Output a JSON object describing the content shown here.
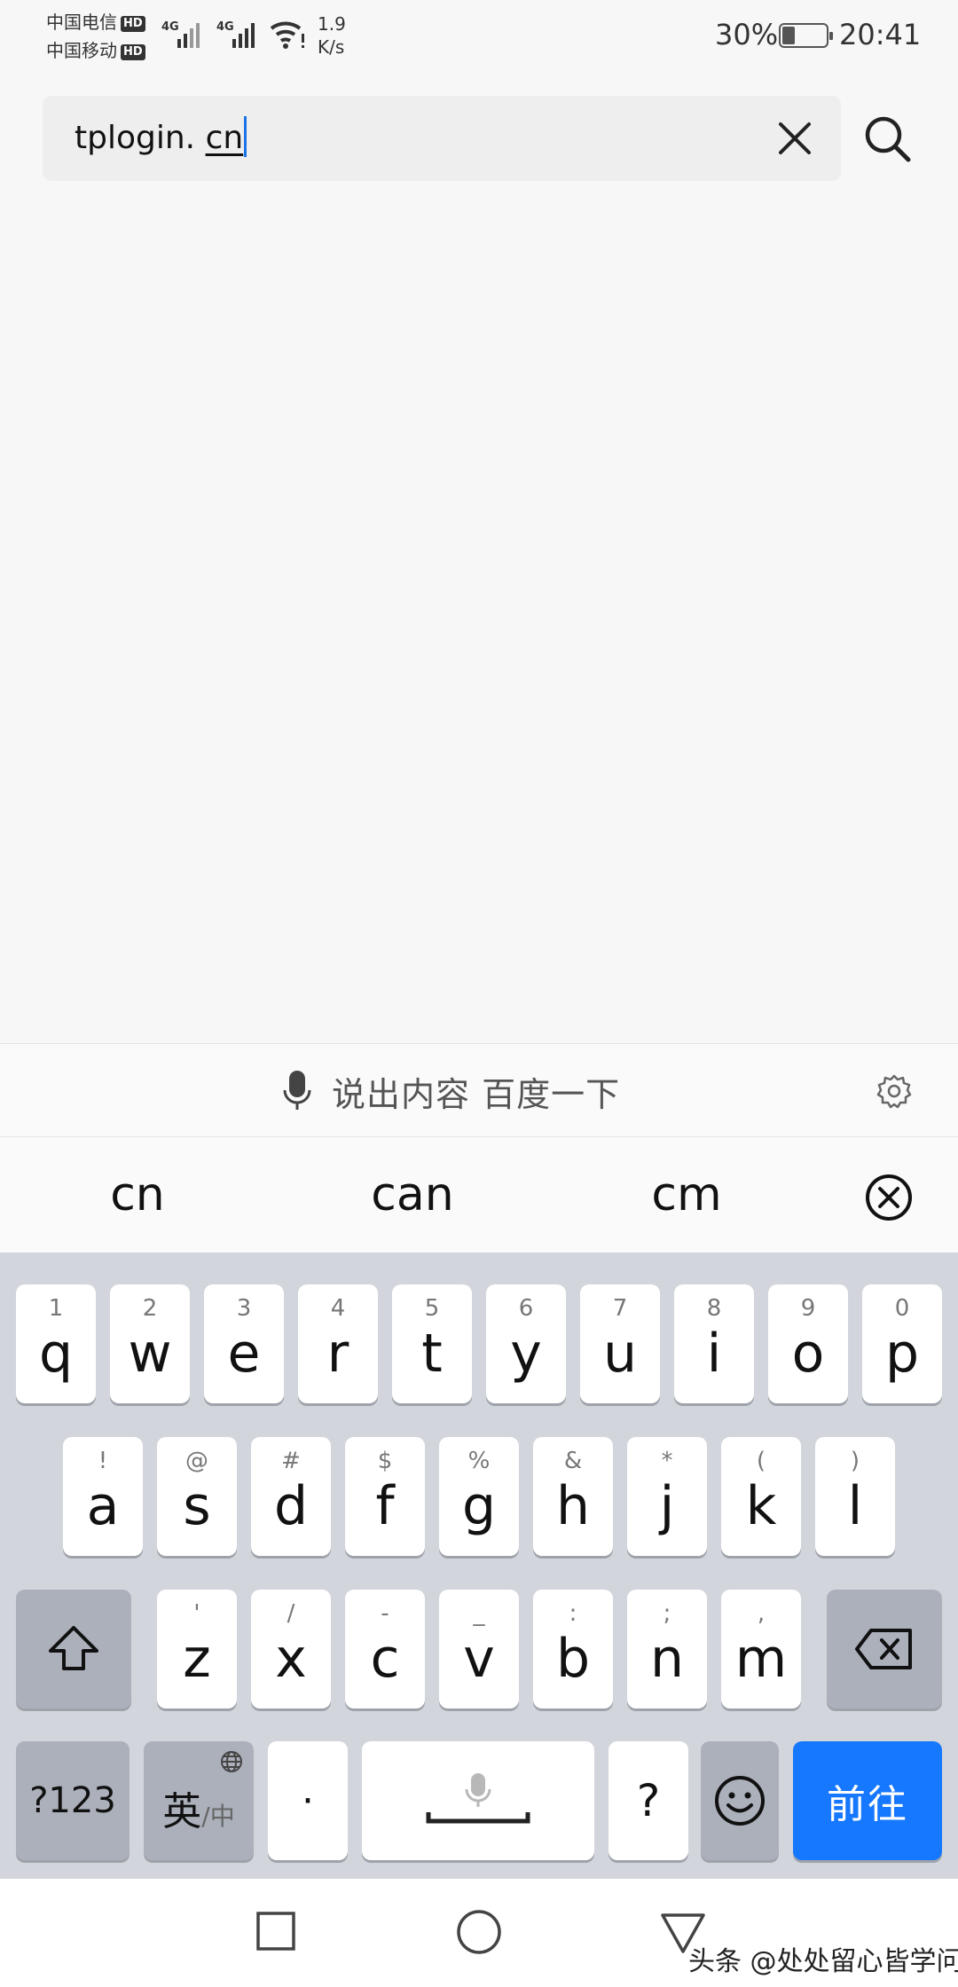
{
  "status_bar": {
    "carrier1": "中国电信",
    "carrier2": "中国移动",
    "hd": "HD",
    "network1": "4G",
    "network2": "4G",
    "speed_value": "1.9",
    "speed_unit": "K/s",
    "battery_percent": "30%",
    "battery_level": 0.3,
    "time": "20:41"
  },
  "search": {
    "typed_prefix": "tplogin. ",
    "composing": "cn"
  },
  "voice_bar": {
    "text": "说出内容 百度一下"
  },
  "candidates": [
    "cn",
    "can",
    "cm"
  ],
  "keyboard": {
    "row1": [
      {
        "sub": "1",
        "main": "q"
      },
      {
        "sub": "2",
        "main": "w"
      },
      {
        "sub": "3",
        "main": "e"
      },
      {
        "sub": "4",
        "main": "r"
      },
      {
        "sub": "5",
        "main": "t"
      },
      {
        "sub": "6",
        "main": "y"
      },
      {
        "sub": "7",
        "main": "u"
      },
      {
        "sub": "8",
        "main": "i"
      },
      {
        "sub": "9",
        "main": "o"
      },
      {
        "sub": "0",
        "main": "p"
      }
    ],
    "row2": [
      {
        "sub": "!",
        "main": "a"
      },
      {
        "sub": "@",
        "main": "s"
      },
      {
        "sub": "#",
        "main": "d"
      },
      {
        "sub": "$",
        "main": "f"
      },
      {
        "sub": "%",
        "main": "g"
      },
      {
        "sub": "&",
        "main": "h"
      },
      {
        "sub": "*",
        "main": "j"
      },
      {
        "sub": "(",
        "main": "k"
      },
      {
        "sub": ")",
        "main": "l"
      }
    ],
    "row3": [
      {
        "sub": "'",
        "main": "z"
      },
      {
        "sub": "/",
        "main": "x"
      },
      {
        "sub": "-",
        "main": "c"
      },
      {
        "sub": "_",
        "main": "v"
      },
      {
        "sub": ":",
        "main": "b"
      },
      {
        "sub": ";",
        "main": "n"
      },
      {
        "sub": ",",
        "main": "m"
      }
    ],
    "sym_label": "?123",
    "lang_main": "英",
    "lang_sub": "/中",
    "dot_label": "·",
    "question_label": "?",
    "go_label": "前往"
  },
  "watermark": "头条 @处处留心皆学问",
  "colors": {
    "accent": "#1677ff",
    "caret": "#1a73e8",
    "keyboard_bg": "#d2d5db"
  }
}
